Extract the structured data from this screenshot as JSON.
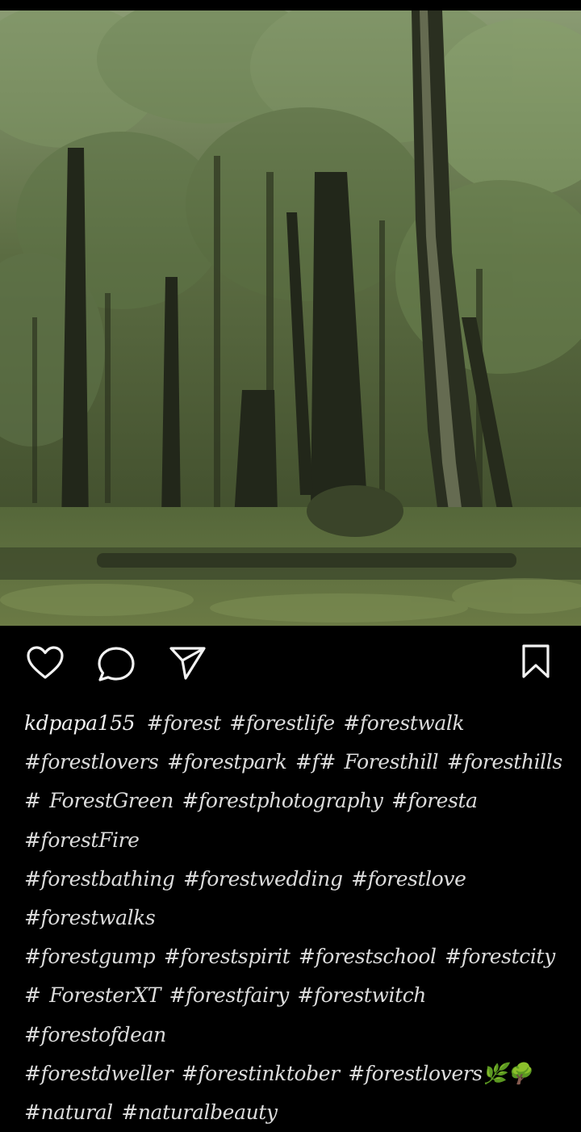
{
  "post": {
    "image_alt": "forest photo",
    "username": "kdpapa155",
    "hashtags": [
      "#forest",
      "#forestlife",
      "#forestwalk",
      "#forestlovers",
      "#forestpark",
      "#f#",
      "Foresthill",
      "#foresthills",
      "# ForestGreen",
      "#forestphotography",
      "#foresta",
      "#forestFire",
      "#forestbathing",
      "#forestwedding",
      "#forestlove",
      "#forestwalks",
      "#forestgump",
      "#forestspirit",
      "#forestschool",
      "#forestcity",
      "# ForesterXT",
      "#forestfairy",
      "#forestwitch",
      "#forestofdean",
      "#forestdweller",
      "#forestinktober",
      "#forestlovers🌿🌳",
      "#natural",
      "#naturalbeauty"
    ]
  },
  "actions": {
    "like_icon": "heart-icon",
    "comment_icon": "comment-bubble-icon",
    "share_icon": "paper-plane-icon",
    "save_icon": "bookmark-icon"
  }
}
